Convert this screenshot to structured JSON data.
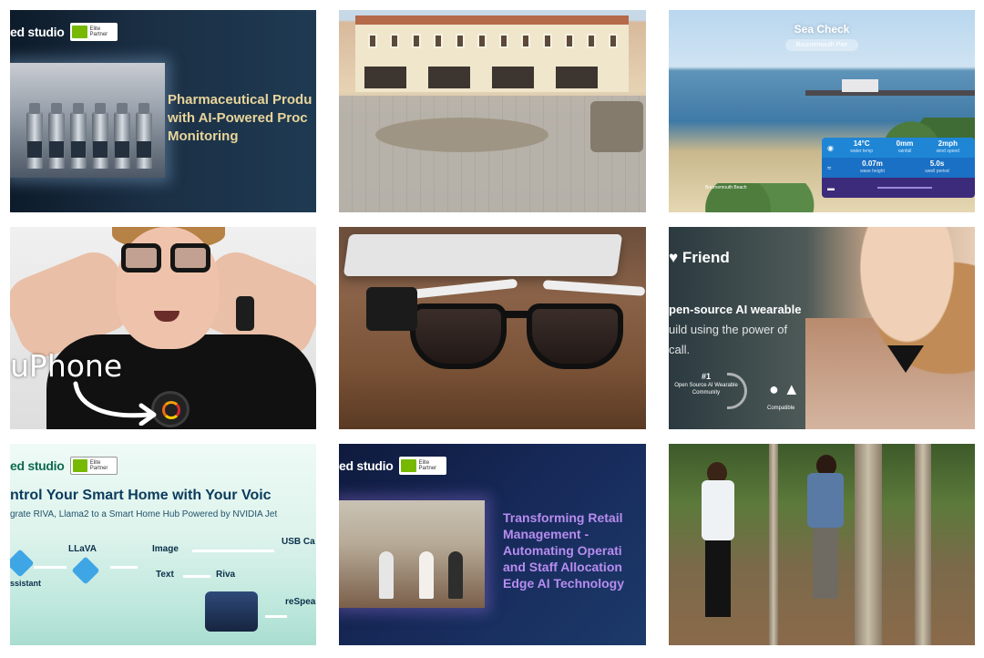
{
  "tiles": {
    "pharma": {
      "brand": "ed studio",
      "partner": "Elite Partner",
      "title_lines": [
        "Pharmaceutical Produ",
        "with AI-Powered Proc",
        "Monitoring"
      ]
    },
    "street": {},
    "sea_check": {
      "title": "Sea Check",
      "location": "Bournemouth Pier",
      "stats_row1": [
        {
          "value": "14°C",
          "label": "water temp"
        },
        {
          "value": "0mm",
          "label": "rainfall"
        },
        {
          "value": "2mph",
          "label": "wind speed"
        }
      ],
      "stats_row2": [
        {
          "value": "0.07m",
          "label": "wave height"
        },
        {
          "value": "5.0s",
          "label": "swell period"
        }
      ],
      "footer": "Bournemouth Beach"
    },
    "uphone": {
      "caption": "uPhone"
    },
    "glasses": {},
    "friend": {
      "logo": "Friend",
      "subtitle_lines": [
        "pen-source AI wearable",
        "uild using the power of",
        "call."
      ],
      "badge_rank": "#1",
      "badge_text": "Open Source AI Wearable Community",
      "compatible": "Compatible"
    },
    "smart_home": {
      "brand": "ed studio",
      "partner": "Elite Partner",
      "title": "ntrol Your Smart Home with Your Voic",
      "subtitle": "grate RIVA, Llama2 to a Smart Home Hub Powered by NVIDIA Jet",
      "labels": {
        "llava": "LLaVA",
        "image": "Image",
        "text": "Text",
        "riva": "Riva",
        "usb": "USB Ca",
        "respeaker": "reSpea",
        "assistant": "ssistant"
      }
    },
    "retail": {
      "brand": "ed studio",
      "partner": "Elite Partner",
      "title_lines": [
        "Transforming Retail",
        "Management -",
        "Automating Operati",
        "and Staff Allocation",
        "Edge AI Technology"
      ]
    },
    "forest": {}
  }
}
